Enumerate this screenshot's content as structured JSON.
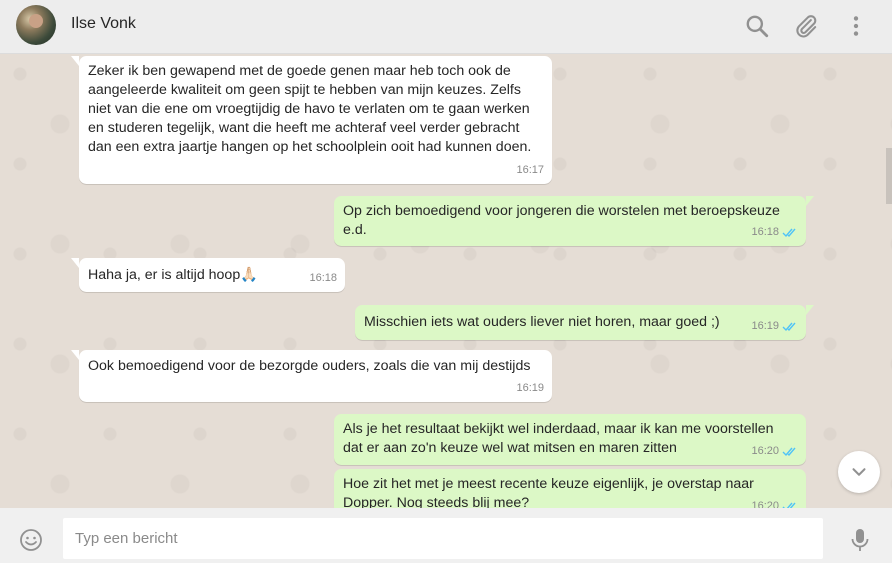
{
  "header": {
    "contact_name": "Ilse Vonk",
    "icons": [
      "search-icon",
      "attach-icon",
      "menu-icon"
    ]
  },
  "messages": [
    {
      "direction": "in",
      "text": "Zeker ik ben gewapend met de goede genen maar heb toch ook de aangeleerde kwaliteit om geen spijt te hebben van mijn keuzes. Zelfs niet van die ene om vroegtijdig de havo te verlaten om te gaan werken en studeren tegelijk, want die heeft me achteraf veel verder gebracht dan een extra jaartje hangen op het schoolplein ooit had kunnen doen.",
      "time": "16:17"
    },
    {
      "direction": "out",
      "text": "Op zich bemoedigend voor jongeren die worstelen met beroepskeuze e.d.",
      "time": "16:18",
      "status": "read"
    },
    {
      "direction": "in",
      "text": "Haha ja, er is altijd hoop🙏🏻",
      "time": "16:18"
    },
    {
      "direction": "out",
      "text": "Misschien iets wat ouders liever niet horen, maar goed ;)",
      "time": "16:19",
      "status": "read"
    },
    {
      "direction": "in",
      "text": "Ook bemoedigend voor de bezorgde ouders, zoals die van mij destijds",
      "time": "16:19"
    },
    {
      "direction": "out",
      "text": "Als je het resultaat bekijkt wel inderdaad, maar ik kan me voorstellen dat er aan zo'n keuze wel wat mitsen en maren zitten",
      "time": "16:20",
      "status": "read"
    },
    {
      "direction": "out",
      "text": "Hoe zit het met je meest recente keuze eigenlijk, je overstap naar Dopper. Nog steeds blij mee?",
      "time": "16:20",
      "status": "read"
    }
  ],
  "composer": {
    "placeholder": "Typ een bericht"
  },
  "colors": {
    "incoming_bubble": "#ffffff",
    "outgoing_bubble": "#dcf8c6",
    "read_ticks": "#4fc3f7",
    "chat_background": "#e5ddd5",
    "header_background": "#ededed"
  }
}
